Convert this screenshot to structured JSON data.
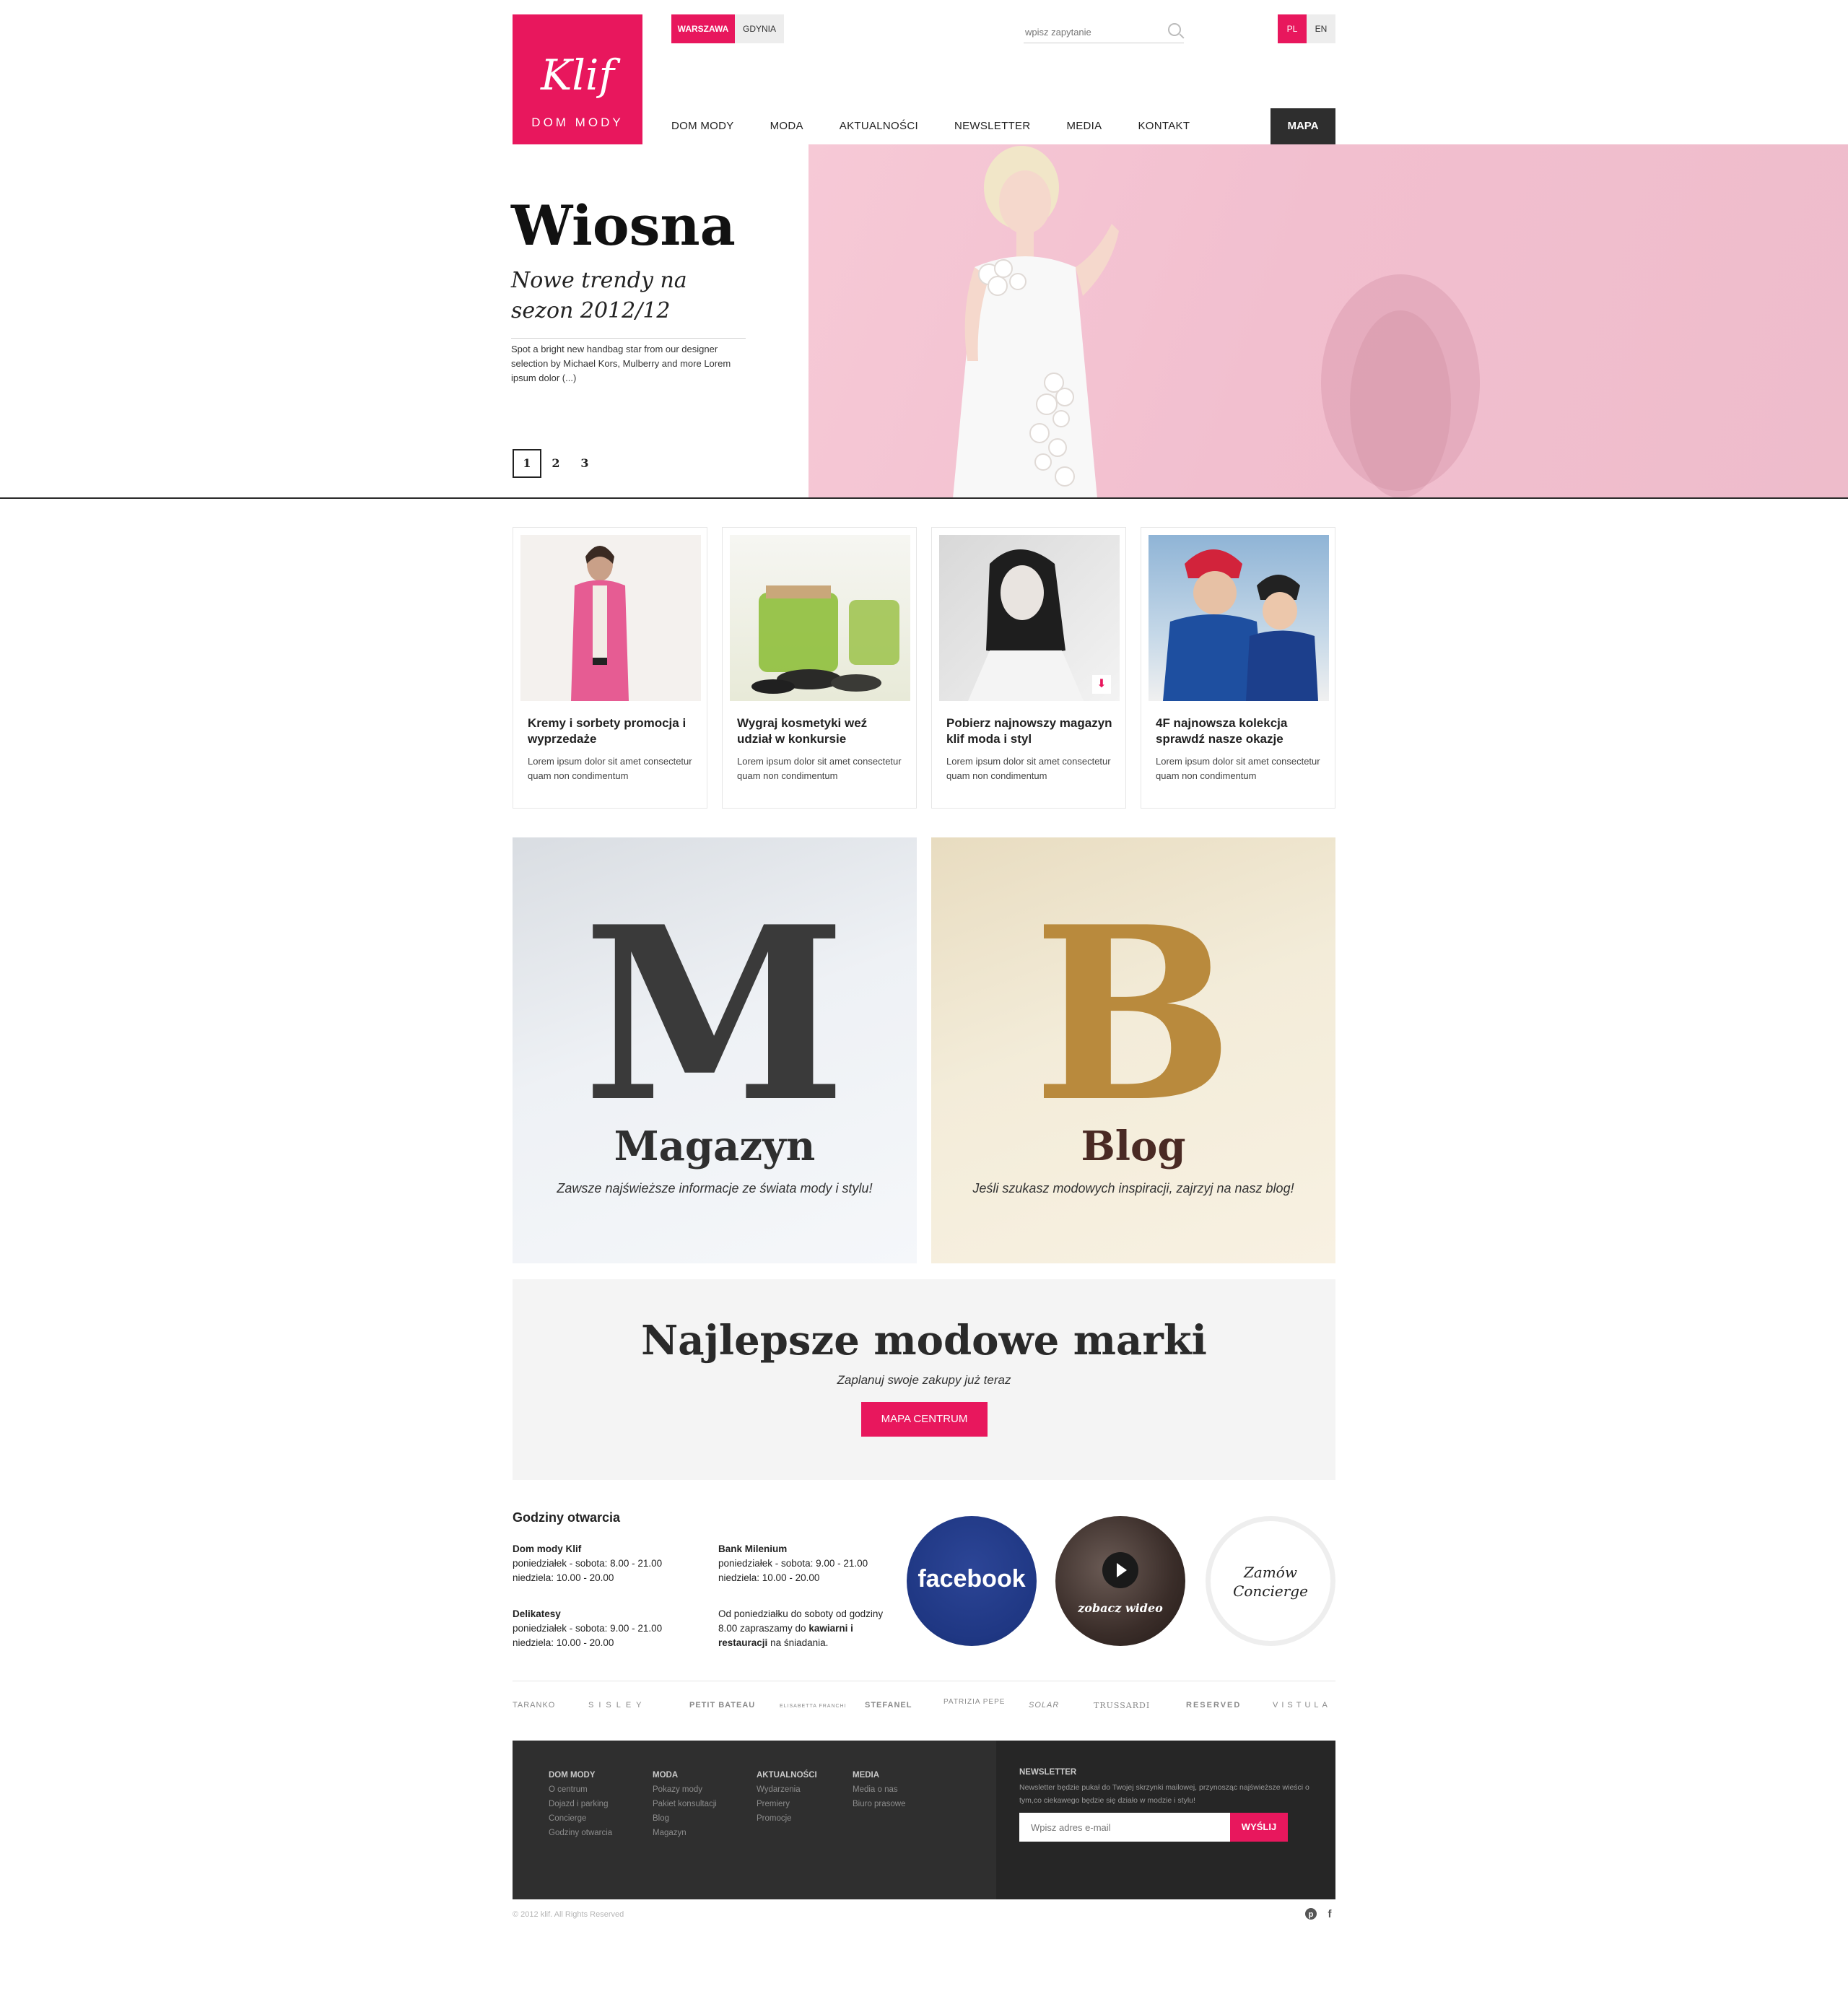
{
  "brand": {
    "logo_script": "Klif",
    "logo_sub": "DOM MODY",
    "accent": "#e8175d",
    "dark": "#2e2e2e"
  },
  "cities": {
    "active": "WARSZAWA",
    "inactive": "GDYNIA"
  },
  "search": {
    "placeholder": "wpisz zapytanie",
    "icon": "search-icon"
  },
  "lang": {
    "pl": "PL",
    "en": "EN"
  },
  "nav": {
    "items": [
      "DOM MODY",
      "MODA",
      "AKTUALNOŚCI",
      "NEWSLETTER",
      "MEDIA",
      "KONTAKT"
    ],
    "map_button": "MAPA"
  },
  "hero": {
    "title": "Wiosna",
    "subtitle": "Nowe trendy na sezon 2012/12",
    "description": "Spot a bright new handbag star from our designer selection by Michael Kors, Mulberry and more Lorem ipsum dolor (...)",
    "pages": [
      "1",
      "2",
      "3"
    ],
    "active_page": "1",
    "bg_color": "#f2c2d1"
  },
  "cards": [
    {
      "title": "Kremy i sorbety promocja i wyprzedaże",
      "text": "Lorem ipsum dolor sit amet consectetur quam non condimentum"
    },
    {
      "title": "Wygraj kosmetyki weź udział w konkursie",
      "text": "Lorem ipsum dolor sit amet consectetur quam non condimentum"
    },
    {
      "title": "Pobierz najnowszy magazyn klif moda i styl",
      "text": "Lorem ipsum dolor sit amet consectetur quam non condimentum",
      "badge_icon": "download-icon"
    },
    {
      "title": "4F najnowsza kolekcja sprawdź nasze okazje",
      "text": "Lorem ipsum dolor sit amet consectetur quam non condimentum"
    }
  ],
  "features": {
    "magazine": {
      "letter": "M",
      "title": "Magazyn",
      "text": "Zawsze najświeższe informacje ze świata mody i stylu!"
    },
    "blog": {
      "letter": "B",
      "title": "Blog",
      "text": "Jeśli szukasz modowych inspiracji, zajrzyj na nasz blog!"
    }
  },
  "promo": {
    "title": "Najlepsze modowe marki",
    "subtitle": "Zaplanuj swoje zakupy już teraz",
    "button": "MAPA CENTRUM"
  },
  "hours": {
    "title": "Godziny otwarcia",
    "blocks": [
      {
        "name": "Dom mody Klif",
        "line1": "poniedziałek - sobota:  8.00 - 21.00",
        "line2": "niedziela:  10.00 - 20.00"
      },
      {
        "name": "Bank Milenium",
        "line1": "poniedziałek - sobota:  9.00 - 21.00",
        "line2": "niedziela:  10.00 - 20.00"
      },
      {
        "name": "Delikatesy",
        "line1": "poniedziałek - sobota:  9.00 - 21.00",
        "line2": "niedziela:  10.00 - 20.00"
      }
    ],
    "note_pre": "Od poniedziałku do soboty od godziny 8.00 zapraszamy do",
    "note_bold": "kawiarni i restauracji",
    "note_post": "na śniadania."
  },
  "circles": {
    "facebook": "facebook",
    "video": "zobacz wideo",
    "concierge": "Zamów Concierge",
    "fb_color": "#1f3783"
  },
  "brand_logos": [
    "TARANKO",
    "SISLEY",
    "PETIT BATEAU",
    "ELISABETTA FRANCHI",
    "STEFANEL",
    "PATRIZIA PEPE",
    "SOLAR",
    "TRUSSARDI",
    "RESERVED",
    "VISTULA"
  ],
  "footer": {
    "columns": [
      {
        "head": "DOM MODY",
        "links": [
          "O centrum",
          "Dojazd i parking",
          "Concierge",
          "Godziny otwarcia"
        ]
      },
      {
        "head": "MODA",
        "links": [
          "Pokazy mody",
          "Pakiet konsultacji",
          "Blog",
          "Magazyn"
        ]
      },
      {
        "head": "AKTUALNOŚCI",
        "links": [
          "Wydarzenia",
          "Premiery",
          "Promocje"
        ]
      },
      {
        "head": "MEDIA",
        "links": [
          "Media o nas",
          "Biuro prasowe"
        ]
      }
    ],
    "newsletter": {
      "head": "NEWSLETTER",
      "text": "Newsletter będzie pukał do Twojej skrzynki mailowej, przynosząc najświeższe wieści o tym,co ciekawego będzie się działo w modzie i stylu!",
      "placeholder": "Wpisz adres e-mail",
      "button": "WYŚLIJ"
    }
  },
  "copyright": "© 2012 klif. All Rights Reserved",
  "social": {
    "pinterest": "pinterest-icon",
    "facebook": "facebook-icon"
  }
}
